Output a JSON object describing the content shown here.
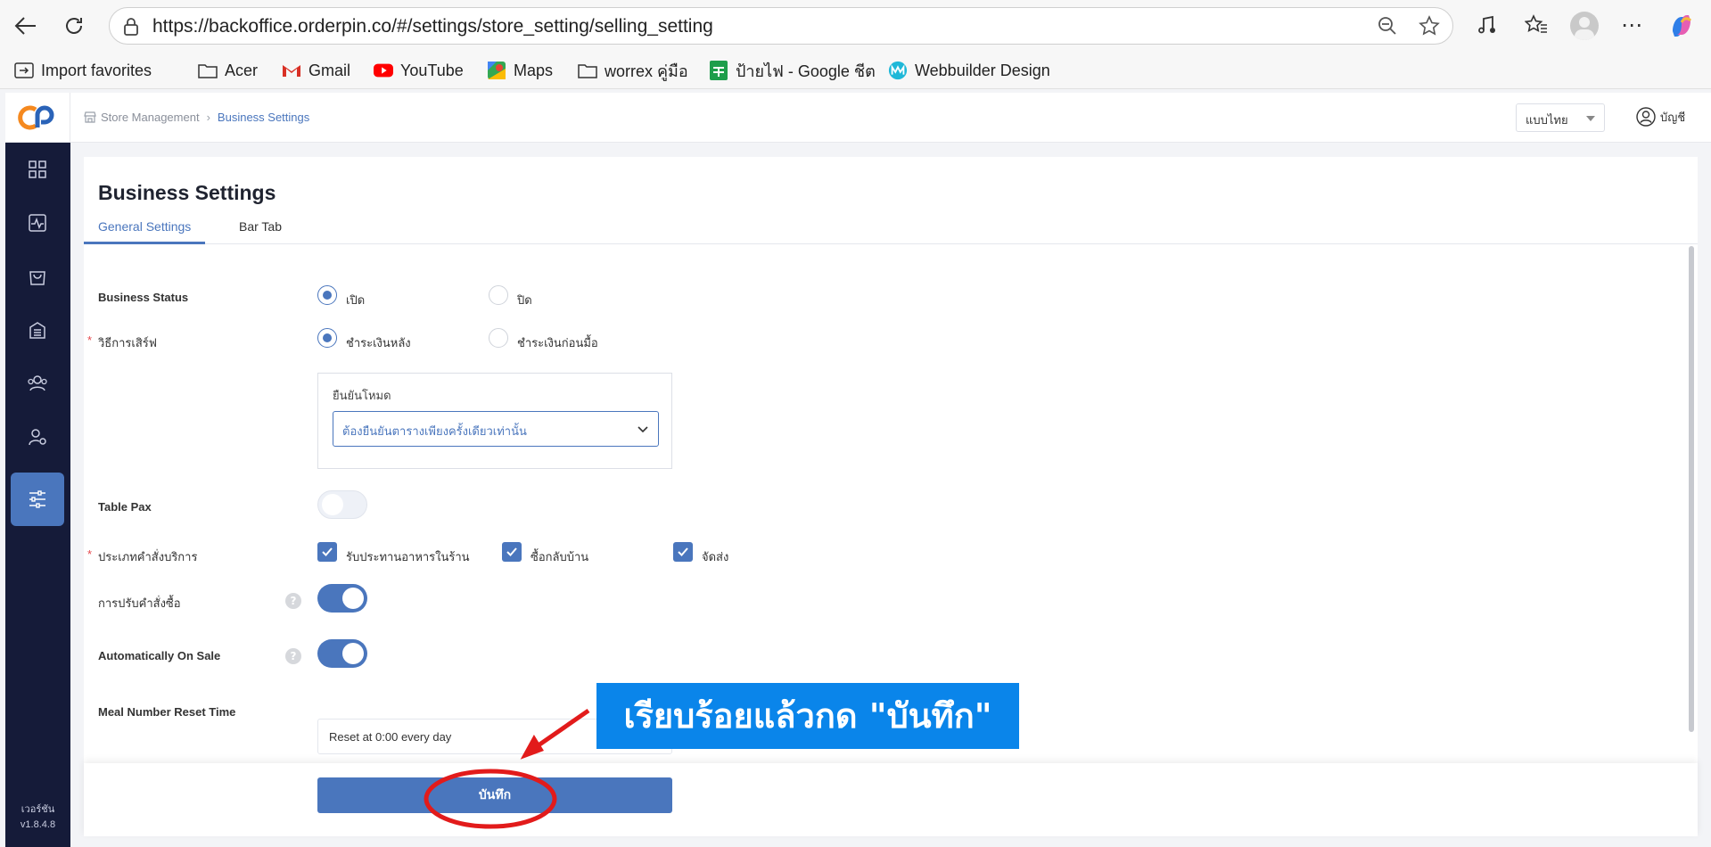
{
  "browser": {
    "url": "https://backoffice.orderpin.co/#/settings/store_setting/selling_setting",
    "bookmarks": [
      {
        "label": "Import favorites",
        "icon": "import-icon"
      },
      {
        "label": "Acer",
        "icon": "folder-icon"
      },
      {
        "label": "Gmail",
        "icon": "gmail-icon"
      },
      {
        "label": "YouTube",
        "icon": "youtube-icon"
      },
      {
        "label": "Maps",
        "icon": "maps-icon"
      },
      {
        "label": "worrex คู่มือ",
        "icon": "folder-icon"
      },
      {
        "label": "ป้ายไฟ - Google ชีต",
        "icon": "sheets-icon"
      },
      {
        "label": "Webbuilder Design",
        "icon": "webbuilder-icon"
      }
    ]
  },
  "header": {
    "breadcrumb": [
      "Store Management",
      "Business Settings"
    ],
    "language": "แบบไทย",
    "account": "บัญชี"
  },
  "sidebar": {
    "items": [
      "dashboard-icon",
      "activity-icon",
      "shopping-bag-icon",
      "building-icon",
      "users-icon",
      "user-settings-icon",
      "sliders-icon"
    ],
    "active_index": 6,
    "version_label": "เวอร์ชัน",
    "version": "v1.8.4.8"
  },
  "page": {
    "title": "Business Settings",
    "tabs": [
      "General Settings",
      "Bar Tab"
    ],
    "active_tab": 0
  },
  "form": {
    "business_status": {
      "label": "Business Status",
      "options": [
        "เปิด",
        "ปิด"
      ],
      "selected": 0
    },
    "service_method": {
      "label": "วิธีการเสิร์ฟ",
      "required": "*",
      "options": [
        "ชำระเงินหลัง",
        "ชำระเงินก่อนมื้อ"
      ],
      "selected": 0
    },
    "confirm_mode": {
      "label": "ยืนยันโหมด",
      "value": "ต้องยืนยันตารางเพียงครั้งเดียวเท่านั้น"
    },
    "table_pax": {
      "label": "Table Pax",
      "enabled": false
    },
    "order_types": {
      "label": "ประเภทคำสั่งบริการ",
      "required": "*",
      "options": [
        "รับประทานอาหารในร้าน",
        "ซื้อกลับบ้าน",
        "จัดส่ง"
      ]
    },
    "order_adjust": {
      "label": "การปรับคำสั่งซื้อ",
      "enabled": true
    },
    "auto_on_sale": {
      "label": "Automatically On Sale",
      "enabled": true
    },
    "meal_reset": {
      "label": "Meal Number Reset Time",
      "value": "Reset at 0:00 every day"
    },
    "help_glyph": "?"
  },
  "footer": {
    "save_label": "บันทึก"
  },
  "annotation": {
    "text": "เรียบร้อยแล้วกด \"บันทึก\""
  },
  "colors": {
    "accent": "#4a76bd",
    "sidebar": "#151b39",
    "annotation": "#0a85ea",
    "highlight": "#e21b1b"
  }
}
